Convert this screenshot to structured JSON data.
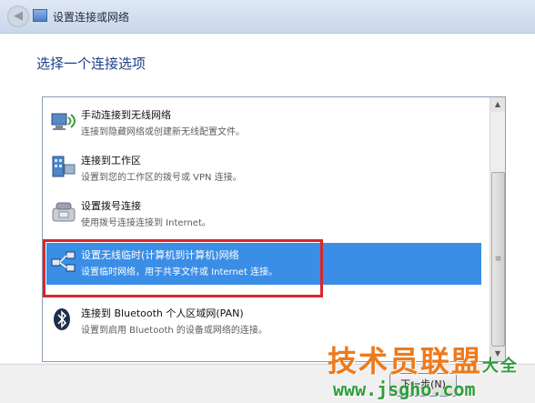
{
  "window": {
    "title": "设置连接或网络",
    "back_glyph": "◀"
  },
  "heading": "选择一个连接选项",
  "options": [
    {
      "title": "手动连接到无线网络",
      "description": "连接到隐藏网络或创建新无线配置文件。",
      "icon": "wireless-network-icon"
    },
    {
      "title": "连接到工作区",
      "description": "设置到您的工作区的拨号或 VPN 连接。",
      "icon": "workplace-icon"
    },
    {
      "title": "设置拨号连接",
      "description": "使用拨号连接连接到 Internet。",
      "icon": "dialup-phone-icon"
    },
    {
      "title": "设置无线临时(计算机到计算机)网络",
      "description": "设置临时网络，用于共享文件或 Internet 连接。",
      "icon": "adhoc-network-icon",
      "selected": true
    },
    {
      "title": "连接到 Bluetooth 个人区域网(PAN)",
      "description": "设置到启用 Bluetooth 的设备或网络的连接。",
      "icon": "bluetooth-icon"
    }
  ],
  "scrollbar": {
    "up": "▲",
    "down": "▼",
    "grip": "≡"
  },
  "footer": {
    "next_label": "下一步(N)"
  },
  "watermark": {
    "brand": "技术员联盟",
    "url": "www.jsgho.com",
    "suffix": "大全"
  },
  "colors": {
    "selection": "#3a8ee6",
    "highlight_border": "#d9262c",
    "heading": "#1e3f8a",
    "watermark_brand": "#ee7a1c",
    "watermark_url": "#2f9e3c"
  }
}
